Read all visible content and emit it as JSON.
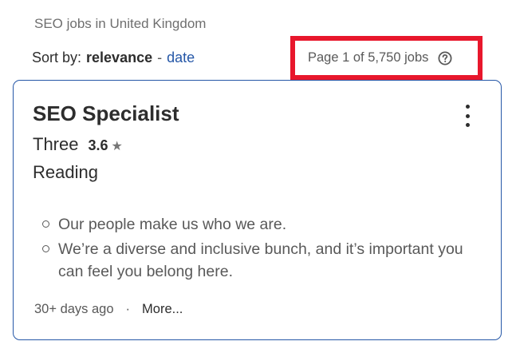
{
  "breadcrumb": "SEO jobs in United Kingdom",
  "sort": {
    "label": "Sort by:",
    "current": "relevance",
    "separator": "-",
    "alternative": "date"
  },
  "page_count": "Page 1 of 5,750 jobs",
  "job": {
    "title": "SEO Specialist",
    "company": "Three",
    "rating": "3.6",
    "star_icon": "star-icon",
    "location": "Reading",
    "snippet": [
      "Our people make us who we are.",
      "We’re a diverse and inclusive bunch, and it’s important you can feel you belong here."
    ],
    "posted": "30+ days ago",
    "footer_separator": "·",
    "more_label": "More..."
  },
  "colors": {
    "link": "#2557a7",
    "highlight_border": "#e8172c",
    "text": "#2d2d2d",
    "muted": "#595959"
  }
}
